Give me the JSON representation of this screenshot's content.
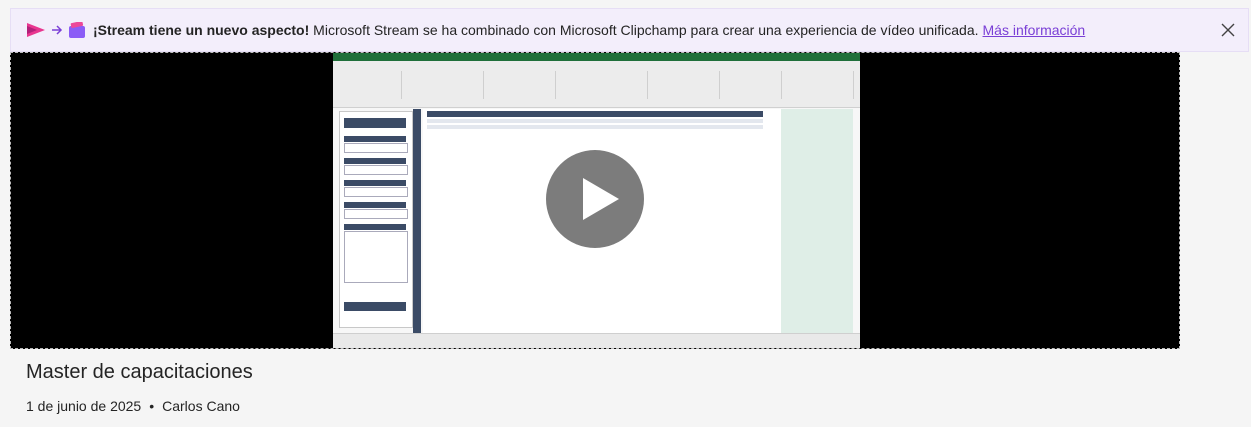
{
  "banner": {
    "headline": "¡Stream tiene un nuevo aspecto!",
    "message": " Microsoft Stream se ha combinado con Microsoft Clipchamp para crear una experiencia de vídeo unificada.",
    "link_label": "Más información",
    "close_icon": "close-icon",
    "logo_icons": [
      "stream-logo-icon",
      "arrow-right-icon",
      "clipchamp-logo-icon"
    ]
  },
  "player": {
    "play_icon": "play-icon"
  },
  "video": {
    "title": "Master de capacitaciones",
    "date": "1 de junio de 2025",
    "separator": "•",
    "author": "Carlos Cano"
  },
  "colors": {
    "banner_bg": "#f3eefb",
    "link": "#7a3fd6",
    "stream_pink": "#e8368f",
    "excel_green": "#1f6f3a",
    "navy": "#3b4b66"
  }
}
